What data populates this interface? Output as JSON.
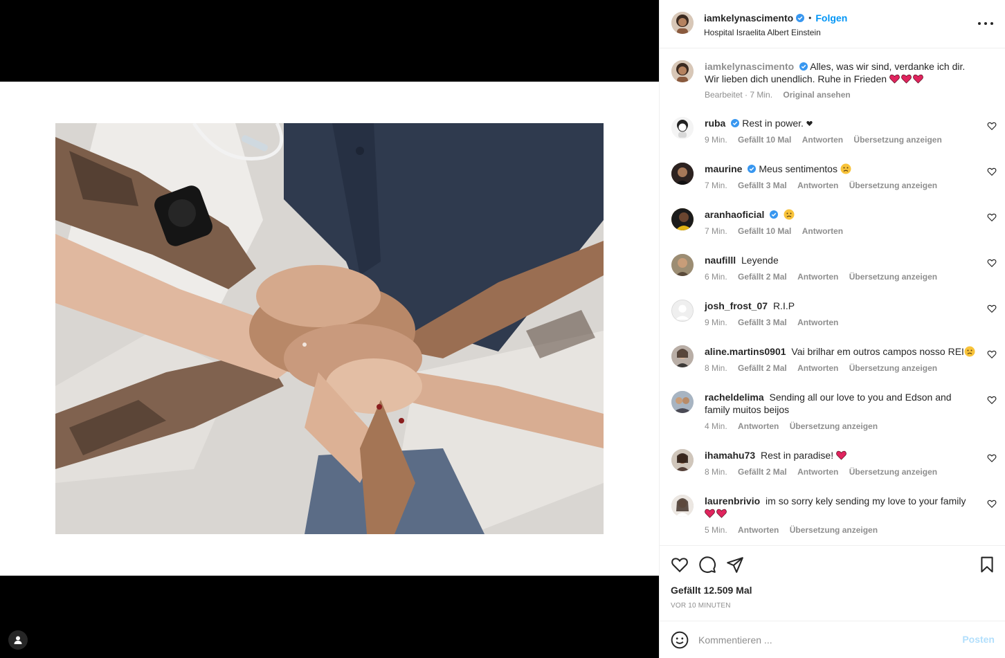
{
  "post": {
    "author": "iamkelynascimento",
    "follow_label": "Folgen",
    "separator": "•",
    "location": "Hospital Israelita Albert Einstein",
    "caption_text": "Alles, was wir sind, verdanke ich dir. Wir lieben dich unendlich. Ruhe in Frieden",
    "caption_time": "Bearbeitet · 7 Min.",
    "caption_link": "Original ansehen",
    "likes": "Gefällt 12.509 Mal",
    "posted_ago": "VOR 10 MINUTEN"
  },
  "comments": [
    {
      "user": "ruba",
      "verified": true,
      "text": "Rest in power.",
      "time": "9 Min.",
      "likes": "Gefällt 10 Mal",
      "reply": "Antworten",
      "translate": "Übersetzung anzeigen",
      "avatar_color": "#e8e8e8"
    },
    {
      "user": "maurine",
      "verified": true,
      "text": "Meus sentimentos",
      "time": "7 Min.",
      "likes": "Gefällt 3 Mal",
      "reply": "Antworten",
      "translate": "Übersetzung anzeigen",
      "avatar_color": "#3b2f2a"
    },
    {
      "user": "aranhaoficial",
      "verified": true,
      "text": "",
      "time": "7 Min.",
      "likes": "Gefällt 10 Mal",
      "reply": "Antworten",
      "translate": "",
      "avatar_color": "#c9a227"
    },
    {
      "user": "naufilll",
      "verified": false,
      "text": "Leyende",
      "time": "6 Min.",
      "likes": "Gefällt 2 Mal",
      "reply": "Antworten",
      "translate": "Übersetzung anzeigen",
      "avatar_color": "#7a6a52"
    },
    {
      "user": "josh_frost_07",
      "verified": false,
      "text": "R.I.P",
      "time": "9 Min.",
      "likes": "Gefällt 3 Mal",
      "reply": "Antworten",
      "translate": "",
      "avatar_color": "#efefef"
    },
    {
      "user": "aline.martins0901",
      "verified": false,
      "text": "Vai brilhar em outros campos nosso REI",
      "time": "8 Min.",
      "likes": "Gefällt 2 Mal",
      "reply": "Antworten",
      "translate": "Übersetzung anzeigen",
      "avatar_color": "#6d5a4f"
    },
    {
      "user": "racheldelima",
      "verified": false,
      "text": "Sending all our love to you and Edson and family muitos beijos",
      "time": "4 Min.",
      "likes": "",
      "reply": "Antworten",
      "translate": "Übersetzung anzeigen",
      "avatar_color": "#8a7f78"
    },
    {
      "user": "ihamahu73",
      "verified": false,
      "text": "Rest in paradise!",
      "time": "8 Min.",
      "likes": "Gefällt 2 Mal",
      "reply": "Antworten",
      "translate": "Übersetzung anzeigen",
      "avatar_color": "#4e3b33"
    },
    {
      "user": "laurenbrivio",
      "verified": false,
      "text": "im so sorry kely sending my love to your family",
      "time": "5 Min.",
      "likes": "",
      "reply": "Antworten",
      "translate": "Übersetzung anzeigen",
      "avatar_color": "#d7c9c0"
    }
  ],
  "comment_box": {
    "placeholder": "Kommentieren ...",
    "post_label": "Posten"
  },
  "icons": {
    "verified": "verified-badge-icon",
    "like": "heart-icon",
    "comment": "comment-bubble-icon",
    "share": "paper-plane-icon",
    "save": "bookmark-icon",
    "emoji": "smiley-icon",
    "more": "more-dots-icon",
    "tag": "user-tag-icon"
  },
  "colors": {
    "accent": "#0095f6",
    "verified": "#3897f0",
    "heart_emoji": "#e0245e",
    "muted": "#8e8e8e",
    "post_button_disabled": "#b2dffc"
  }
}
